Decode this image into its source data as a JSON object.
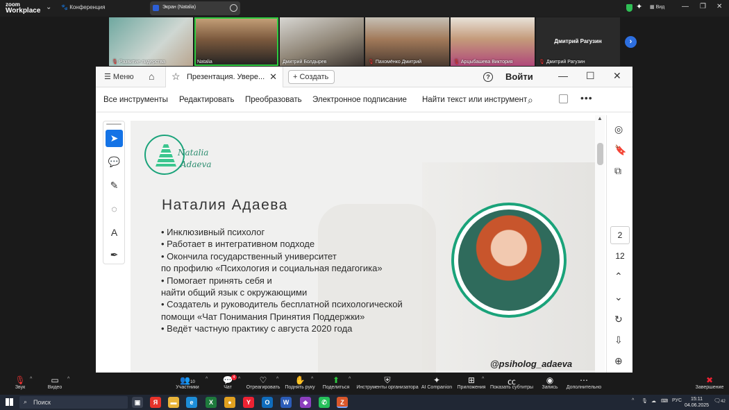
{
  "zoom": {
    "logo_line1": "zoom",
    "logo_line2": "Workplace",
    "conference_label": "Конференция",
    "screen_share_label": "Экран (Natalia)",
    "view_label": "Вид"
  },
  "participants": [
    {
      "name": "Развитие лидерства",
      "muted": true
    },
    {
      "name": "Natalia",
      "muted": false,
      "active": true
    },
    {
      "name": "Дмитрий Болдырев",
      "muted": false
    },
    {
      "name": "Пахомёнко Дмитрий",
      "muted": true
    },
    {
      "name": "Арцыбашева Виктория",
      "muted": true
    },
    {
      "name": "Дмитрий Рагузин",
      "muted": true,
      "video_off": true
    }
  ],
  "acrobat": {
    "menu_label": "Меню",
    "tab_title": "Презентация. Увере...",
    "create_label": "Создать",
    "login_label": "Войти",
    "tools": [
      "Все инструменты",
      "Редактировать",
      "Преобразовать",
      "Электронное подписание",
      "Найти текст или инструмент"
    ],
    "current_page": "2",
    "total_pages": "12"
  },
  "slide": {
    "logo_line1": "Natalia",
    "logo_line2": "Adaeva",
    "name": "Наталия Адаева",
    "bullets": [
      "• Инклюзивный психолог",
      "• Работает в интегративном подходе",
      "• Окончила государственный университет",
      "по профилю «Психология и социальная педагогика»",
      "• Помогает принять себя и",
      "найти общий язык с окружающими",
      "• Создатель и руководитель бесплатной психологической",
      "помощи «Чат Понимания Принятия Поддержки»",
      "• Ведёт частную практику с августа 2020 года"
    ],
    "handle": "@psiholog_adaeva"
  },
  "bottombar": {
    "audio": "Звук",
    "video": "Видео",
    "participants": "Участники",
    "participants_count": "10",
    "chat": "Чат",
    "chat_badge": "4",
    "react": "Отреагировать",
    "raise_hand": "Поднять руку",
    "share": "Поделиться",
    "host_tools": "Инструменты организатора",
    "ai": "AI Companion",
    "apps": "Приложения",
    "captions": "Показать субтитры",
    "record": "Запись",
    "more": "Дополнительно",
    "end": "Завершение"
  },
  "taskbar": {
    "search_label": "Поиск",
    "lang": "РУС",
    "time": "15:11",
    "date": "04.06.2025",
    "notif_count": "42"
  }
}
